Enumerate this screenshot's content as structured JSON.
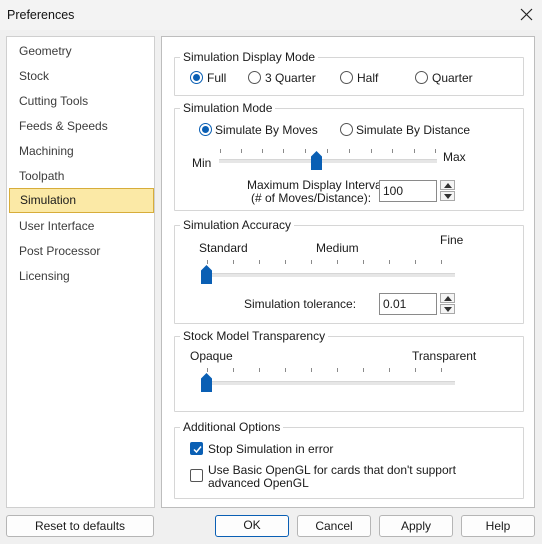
{
  "window": {
    "title": "Preferences"
  },
  "sidebar": {
    "items": [
      {
        "label": "Geometry"
      },
      {
        "label": "Stock"
      },
      {
        "label": "Cutting Tools"
      },
      {
        "label": "Feeds & Speeds"
      },
      {
        "label": "Machining"
      },
      {
        "label": "Toolpath"
      },
      {
        "label": "Simulation",
        "selected": true
      },
      {
        "label": "User Interface"
      },
      {
        "label": "Post Processor"
      },
      {
        "label": "Licensing"
      }
    ]
  },
  "display_mode": {
    "label": "Simulation Display Mode",
    "options": [
      {
        "label": "Full",
        "checked": true
      },
      {
        "label": "3 Quarter",
        "checked": false
      },
      {
        "label": "Half",
        "checked": false
      },
      {
        "label": "Quarter",
        "checked": false
      }
    ]
  },
  "sim_mode": {
    "label": "Simulation Mode",
    "options": [
      {
        "label": "Simulate By Moves",
        "checked": true
      },
      {
        "label": "Simulate By Distance",
        "checked": false
      }
    ],
    "slider": {
      "min_label": "Min",
      "max_label": "Max",
      "value": 0.45
    },
    "interval_label_1": "Maximum Display Interval",
    "interval_label_2": "(# of Moves/Distance):",
    "interval_value": "100"
  },
  "accuracy": {
    "label": "Simulation Accuracy",
    "standard": "Standard",
    "medium": "Medium",
    "fine": "Fine",
    "slider_value": 0.0,
    "tolerance_label": "Simulation tolerance:",
    "tolerance_value": "0.01"
  },
  "transparency": {
    "label": "Stock Model Transparency",
    "opaque": "Opaque",
    "transparent": "Transparent",
    "slider_value": 0.0
  },
  "additional": {
    "label": "Additional Options",
    "stop_on_error": {
      "label": "Stop Simulation in error",
      "checked": true
    },
    "basic_opengl": {
      "label_1": "Use Basic OpenGL for cards that don't support",
      "label_2": "advanced OpenGL",
      "checked": false
    }
  },
  "buttons": {
    "reset": "Reset to defaults",
    "ok": "OK",
    "cancel": "Cancel",
    "apply": "Apply",
    "help": "Help"
  },
  "colors": {
    "accent": "#0a5fb4",
    "selection_bg": "#fbe9a6",
    "selection_border": "#d7ad3a"
  }
}
